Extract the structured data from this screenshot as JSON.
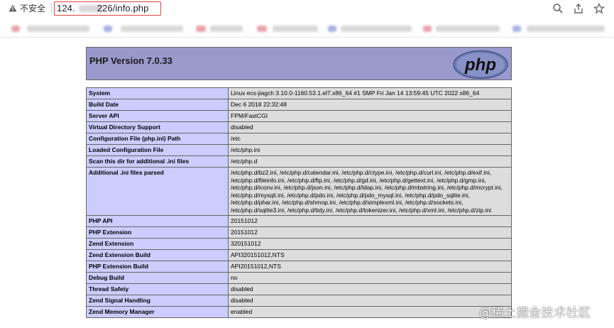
{
  "browser": {
    "security_label": "不安全",
    "url_prefix": "124.",
    "url_suffix": "226/info.php",
    "accent": "#e0443e"
  },
  "header": {
    "title": "PHP Version 7.0.33",
    "logo_text": "php"
  },
  "rows": [
    {
      "key": "System",
      "value": "Linux ecs-jiagch 3.10.0-1160.53.1.el7.x86_64 #1 SMP Fri Jan 14 13:59:45 UTC 2022 x86_64"
    },
    {
      "key": "Build Date",
      "value": "Dec 6 2018 22:32:48"
    },
    {
      "key": "Server API",
      "value": "FPM/FastCGI"
    },
    {
      "key": "Virtual Directory Support",
      "value": "disabled"
    },
    {
      "key": "Configuration File (php.ini) Path",
      "value": "/etc"
    },
    {
      "key": "Loaded Configuration File",
      "value": "/etc/php.ini"
    },
    {
      "key": "Scan this dir for additional .ini files",
      "value": "/etc/php.d"
    },
    {
      "key": "Additional .ini files parsed",
      "value": "/etc/php.d/bz2.ini, /etc/php.d/calendar.ini, /etc/php.d/ctype.ini, /etc/php.d/curl.ini, /etc/php.d/exif.ini, /etc/php.d/fileinfo.ini, /etc/php.d/ftp.ini, /etc/php.d/gd.ini, /etc/php.d/gettext.ini, /etc/php.d/gmp.ini, /etc/php.d/iconv.ini, /etc/php.d/json.ini, /etc/php.d/ldap.ini, /etc/php.d/mbstring.ini, /etc/php.d/mcrypt.ini, /etc/php.d/mysqli.ini, /etc/php.d/pdo.ini, /etc/php.d/pdo_mysql.ini, /etc/php.d/pdo_sqlite.ini, /etc/php.d/phar.ini, /etc/php.d/shmop.ini, /etc/php.d/simplexml.ini, /etc/php.d/sockets.ini, /etc/php.d/sqlite3.ini, /etc/php.d/tidy.ini, /etc/php.d/tokenizer.ini, /etc/php.d/xml.ini, /etc/php.d/zip.ini"
    },
    {
      "key": "PHP API",
      "value": "20151012"
    },
    {
      "key": "PHP Extension",
      "value": "20151012"
    },
    {
      "key": "Zend Extension",
      "value": "320151012"
    },
    {
      "key": "Zend Extension Build",
      "value": "API320151012,NTS"
    },
    {
      "key": "PHP Extension Build",
      "value": "API20151012,NTS"
    },
    {
      "key": "Debug Build",
      "value": "no"
    },
    {
      "key": "Thread Safety",
      "value": "disabled"
    },
    {
      "key": "Zend Signal Handling",
      "value": "disabled"
    },
    {
      "key": "Zend Memory Manager",
      "value": "enabled"
    }
  ],
  "watermark": "@稀土掘金技术社区",
  "icons": {
    "warning": "warning-icon",
    "zoom": "zoom-icon",
    "share": "share-icon",
    "bookmark": "bookmark-star-icon"
  }
}
